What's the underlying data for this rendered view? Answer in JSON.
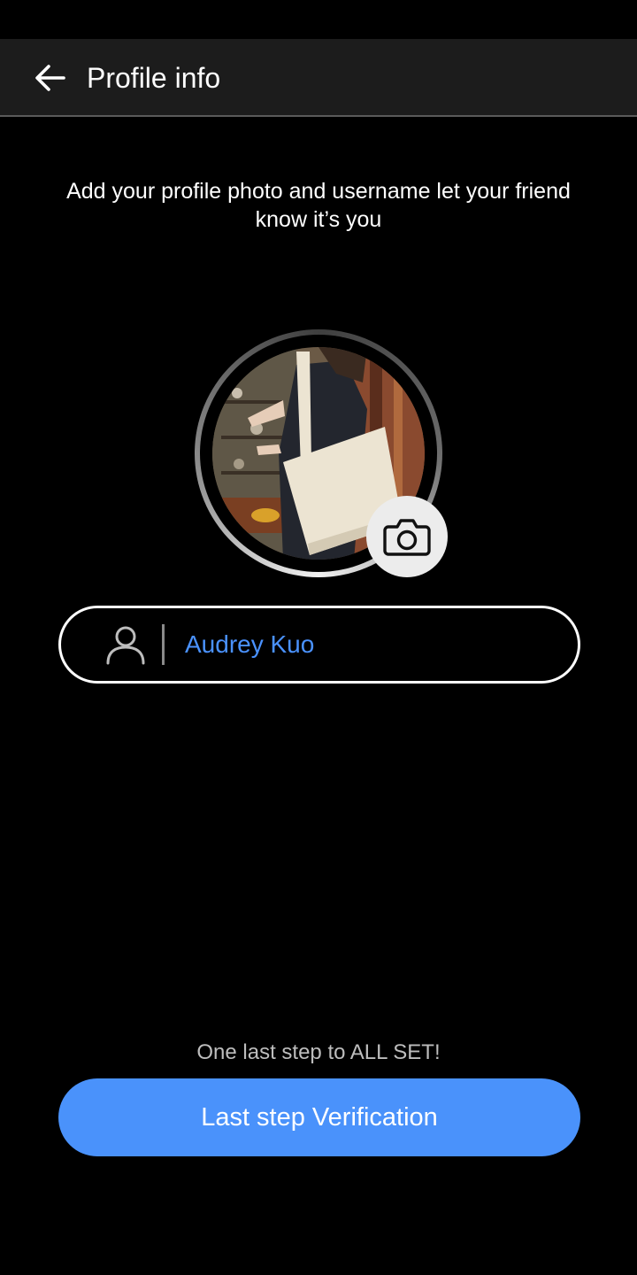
{
  "app_bar": {
    "title": "Profile info",
    "back_icon": "arrow-left-icon"
  },
  "content": {
    "subtitle": "Add your profile photo and username let your friend know it’s you",
    "avatar": {
      "description_icon": "profile-photo",
      "camera_icon": "camera-icon"
    },
    "name_field": {
      "icon": "person-icon",
      "value": "Audrey Kuo"
    }
  },
  "footer": {
    "hint": "One last step to ALL SET!",
    "button_label": "Last step Verification"
  },
  "colors": {
    "accent": "#4a92fb",
    "field_text": "#4a92ff",
    "background": "#000000",
    "app_bar": "#1c1c1c"
  }
}
